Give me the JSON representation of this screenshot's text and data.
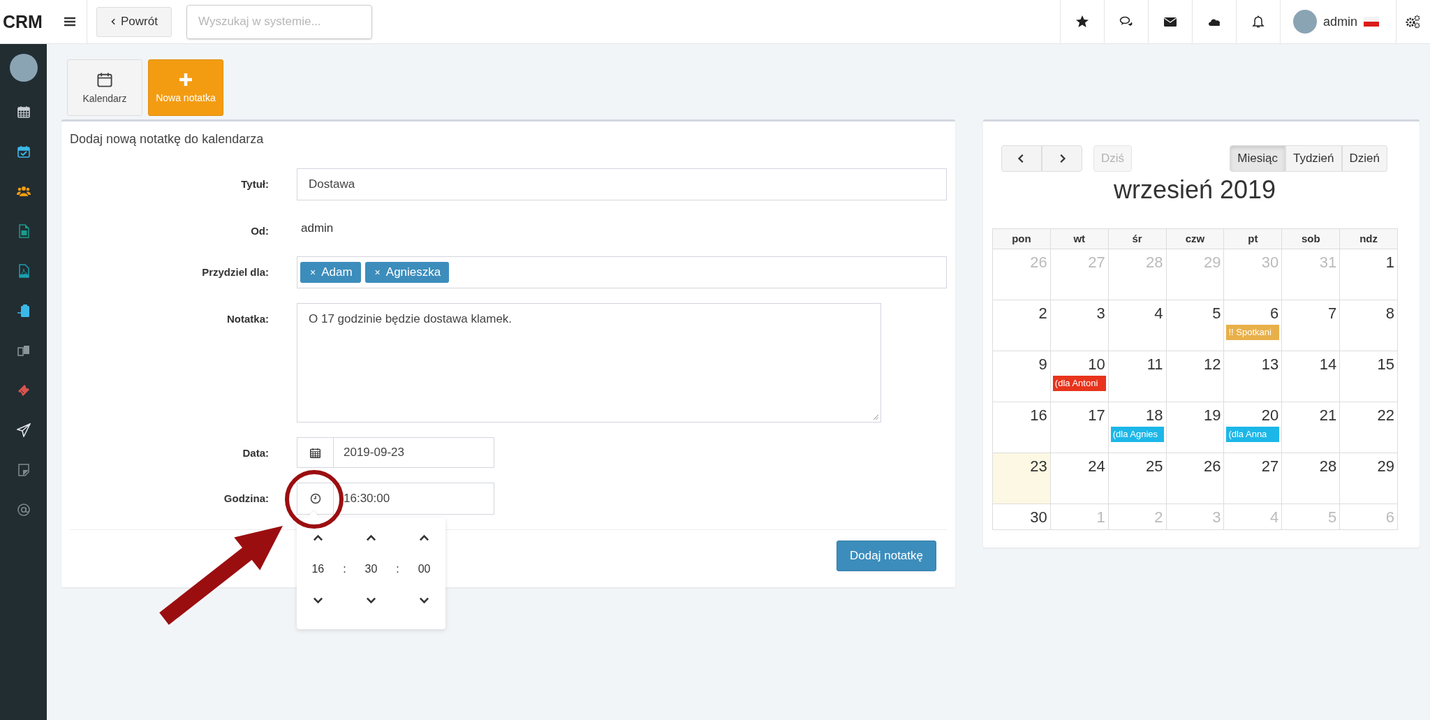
{
  "topbar": {
    "brand": "CRM",
    "back_button": "Powrót",
    "search": {
      "placeholder": "Wyszukaj w systemie..."
    },
    "user": "admin"
  },
  "sidebar": {
    "items": [
      {
        "color": "#c9cfd3"
      },
      {
        "color": "#3bb8e8"
      },
      {
        "color": "#f39c12"
      },
      {
        "color": "#1a9c8c"
      },
      {
        "color": "#1aa0b0"
      },
      {
        "color": "#3bb8e8"
      },
      {
        "color": "#8a969c"
      },
      {
        "color": "#d9534f"
      },
      {
        "color": "#e0e4e6"
      },
      {
        "color": "#7d8a90"
      },
      {
        "color": "#7d8a90"
      }
    ]
  },
  "toolbar": [
    {
      "label": "Kalendarz",
      "kind": "calendar"
    },
    {
      "label": "Nowa notatka",
      "kind": "add"
    }
  ],
  "form": {
    "title": "Dodaj nową notatkę do kalendarza",
    "fields": [
      {
        "label": "Tytuł:",
        "kind": "text",
        "value": "Dostawa"
      },
      {
        "label": "Od:",
        "kind": "static",
        "value": "admin"
      },
      {
        "label": "Przydziel dla:",
        "kind": "tags",
        "tags": [
          {
            "remove": "×",
            "label": "Adam"
          },
          {
            "remove": "×",
            "label": "Agnieszka"
          }
        ]
      },
      {
        "label": "Notatka:",
        "kind": "textarea",
        "value": "O 17 godzinie będzie dostawa klamek."
      },
      {
        "label": "Data:",
        "kind": "date",
        "value": "2019-09-23"
      },
      {
        "label": "Godzina:",
        "kind": "time",
        "value": "16:30:00"
      }
    ],
    "time_picker": {
      "parts": [
        "16",
        "30",
        "00"
      ],
      "separators": [
        ":",
        ":"
      ]
    },
    "submit": "Dodaj notatkę"
  },
  "calendar": {
    "today_button": {
      "label": "Dziś",
      "disabled": true
    },
    "views": [
      {
        "label": "Miesiąc",
        "selected": true
      },
      {
        "label": "Tydzień",
        "selected": false
      },
      {
        "label": "Dzień",
        "selected": false
      }
    ],
    "title": "wrzesień 2019",
    "weekdays": [
      "pon",
      "wt",
      "śr",
      "czw",
      "pt",
      "sob",
      "ndz"
    ],
    "weeks": [
      [
        {
          "day": "26",
          "other_month": true,
          "today": false
        },
        {
          "day": "27",
          "other_month": true,
          "today": false
        },
        {
          "day": "28",
          "other_month": true,
          "today": false
        },
        {
          "day": "29",
          "other_month": true,
          "today": false
        },
        {
          "day": "30",
          "other_month": true,
          "today": false
        },
        {
          "day": "31",
          "other_month": true,
          "today": false
        },
        {
          "day": "1",
          "other_month": false,
          "today": false
        }
      ],
      [
        {
          "day": "2",
          "other_month": false,
          "today": false
        },
        {
          "day": "3",
          "other_month": false,
          "today": false
        },
        {
          "day": "4",
          "other_month": false,
          "today": false
        },
        {
          "day": "5",
          "other_month": false,
          "today": false
        },
        {
          "day": "6",
          "other_month": false,
          "today": false,
          "events": [
            {
              "title": "!! Spotkani",
              "color": "#e8b04a"
            }
          ]
        },
        {
          "day": "7",
          "other_month": false,
          "today": false
        },
        {
          "day": "8",
          "other_month": false,
          "today": false
        }
      ],
      [
        {
          "day": "9",
          "other_month": false,
          "today": false
        },
        {
          "day": "10",
          "other_month": false,
          "today": false,
          "events": [
            {
              "title": "(dla Antoni",
              "color": "#e8341c"
            }
          ]
        },
        {
          "day": "11",
          "other_month": false,
          "today": false
        },
        {
          "day": "12",
          "other_month": false,
          "today": false
        },
        {
          "day": "13",
          "other_month": false,
          "today": false
        },
        {
          "day": "14",
          "other_month": false,
          "today": false
        },
        {
          "day": "15",
          "other_month": false,
          "today": false
        }
      ],
      [
        {
          "day": "16",
          "other_month": false,
          "today": false
        },
        {
          "day": "17",
          "other_month": false,
          "today": false
        },
        {
          "day": "18",
          "other_month": false,
          "today": false,
          "events": [
            {
              "title": "(dla Agnies",
              "color": "#1cb7e8"
            }
          ]
        },
        {
          "day": "19",
          "other_month": false,
          "today": false
        },
        {
          "day": "20",
          "other_month": false,
          "today": false,
          "events": [
            {
              "title": "(dla Anna",
              "color": "#1cb7e8"
            }
          ]
        },
        {
          "day": "21",
          "other_month": false,
          "today": false
        },
        {
          "day": "22",
          "other_month": false,
          "today": false
        }
      ],
      [
        {
          "day": "23",
          "other_month": false,
          "today": true
        },
        {
          "day": "24",
          "other_month": false,
          "today": false
        },
        {
          "day": "25",
          "other_month": false,
          "today": false
        },
        {
          "day": "26",
          "other_month": false,
          "today": false
        },
        {
          "day": "27",
          "other_month": false,
          "today": false
        },
        {
          "day": "28",
          "other_month": false,
          "today": false
        },
        {
          "day": "29",
          "other_month": false,
          "today": false
        }
      ],
      [
        {
          "day": "30",
          "other_month": false,
          "today": false
        },
        {
          "day": "1",
          "other_month": true,
          "today": false
        },
        {
          "day": "2",
          "other_month": true,
          "today": false
        },
        {
          "day": "3",
          "other_month": true,
          "today": false
        },
        {
          "day": "4",
          "other_month": true,
          "today": false
        },
        {
          "day": "5",
          "other_month": true,
          "today": false
        },
        {
          "day": "6",
          "other_month": true,
          "today": false
        }
      ]
    ]
  }
}
